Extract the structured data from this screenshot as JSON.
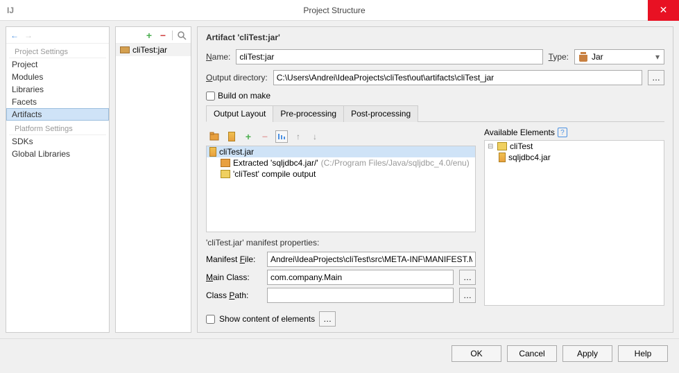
{
  "window": {
    "title": "Project Structure",
    "app_icon": "IJ"
  },
  "nav": {
    "section1": "Project Settings",
    "section2": "Platform Settings",
    "items1": [
      "Project",
      "Modules",
      "Libraries",
      "Facets",
      "Artifacts"
    ],
    "items2": [
      "SDKs",
      "Global Libraries"
    ]
  },
  "artifact_list": {
    "item": "cliTest:jar"
  },
  "panel": {
    "title": "Artifact 'cliTest:jar'",
    "name_label": "Name:",
    "name_value": "cliTest:jar",
    "type_label": "Type:",
    "type_value": "Jar",
    "outdir_label": "Output directory:",
    "outdir_value": "C:\\Users\\Andrei\\IdeaProjects\\cliTest\\out\\artifacts\\cliTest_jar",
    "build_on_make": "Build on make",
    "tabs": [
      "Output Layout",
      "Pre-processing",
      "Post-processing"
    ],
    "tree": {
      "root": "cliTest.jar",
      "child1_a": "Extracted 'sqljdbc4.jar/' ",
      "child1_b": "(C:/Program Files/Java/sqljdbc_4.0/enu)",
      "child2": "'cliTest' compile output"
    },
    "manifest": {
      "title": "'cliTest.jar' manifest properties:",
      "file_label": "Manifest File:",
      "file_value": "Andrei\\IdeaProjects\\cliTest\\src\\META-INF\\MANIFEST.MF",
      "main_label": "Main Class:",
      "main_value": "com.company.Main",
      "path_label": "Class Path:",
      "path_value": ""
    },
    "available": {
      "header": "Available Elements",
      "root": "cliTest",
      "child": "sqljdbc4.jar"
    },
    "show_content": "Show content of elements"
  },
  "buttons": {
    "ok": "OK",
    "cancel": "Cancel",
    "apply": "Apply",
    "help": "Help"
  }
}
